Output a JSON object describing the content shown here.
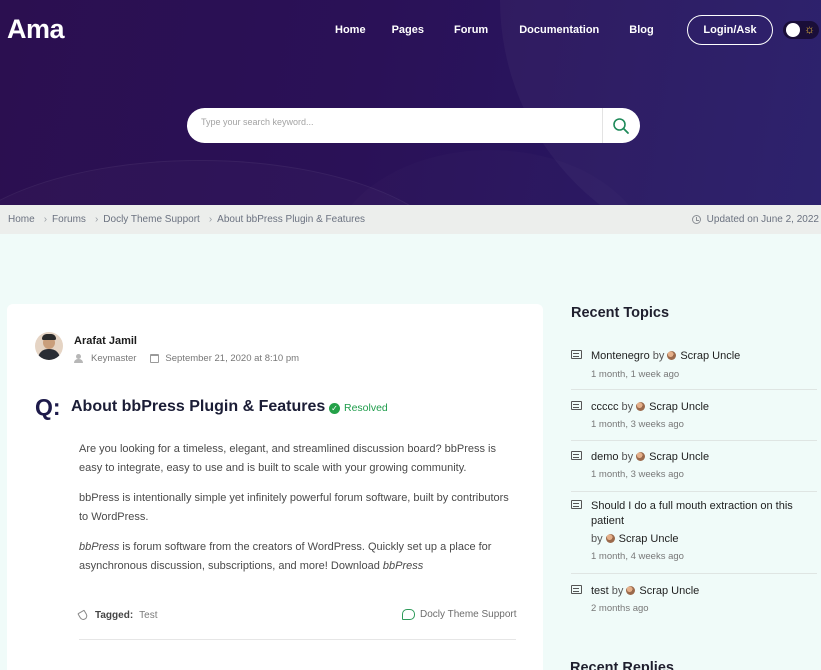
{
  "header": {
    "logo": "Ama",
    "nav": [
      "Home",
      "Pages",
      "Forum",
      "Documentation",
      "Blog"
    ],
    "login_label": "Login/Ask",
    "theme_toggle_icon": "sun-icon"
  },
  "search": {
    "placeholder": "Type your search keyword..."
  },
  "breadcrumb": {
    "items": [
      "Home",
      "Forums",
      "Docly Theme Support",
      "About bbPress Plugin & Features"
    ],
    "updated": "Updated on June 2, 2022"
  },
  "post": {
    "author": "Arafat Jamil",
    "role": "Keymaster",
    "date": "September 21, 2020 at 8:10 pm",
    "q_mark": "Q:",
    "title": "About bbPress Plugin & Features",
    "status": "Resolved",
    "p1": "Are you looking for a timeless, elegant, and streamlined discussion board? bbPress is easy to integrate, easy to use and is built to scale with your growing community.",
    "p2": "bbPress is intentionally simple yet infinitely powerful forum software, built by contributors to WordPress.",
    "p3_em": "bbPress",
    "p3_text": " is forum software from the creators of WordPress. Quickly set up a place for asynchronous discussion, subscriptions, and more! Download ",
    "p3_em2": "bbPress",
    "tagged_label": "Tagged:",
    "tag": "Test",
    "forum": "Docly Theme Support"
  },
  "sidebar": {
    "recent_topics_title": "Recent Topics",
    "by_label": "by",
    "topics": [
      {
        "title": "Montenegro",
        "user": "Scrap Uncle",
        "time": "1 month, 1 week ago"
      },
      {
        "title": "ccccc",
        "user": "Scrap Uncle",
        "time": "1 month, 3 weeks ago"
      },
      {
        "title": "demo",
        "user": "Scrap Uncle",
        "time": "1 month, 3 weeks ago"
      },
      {
        "title": "Should I do a full mouth extraction on this patient",
        "user": "Scrap Uncle",
        "time": "1 month, 4 weeks ago"
      },
      {
        "title": "test",
        "user": "Scrap Uncle",
        "time": "2 months ago"
      }
    ],
    "recent_replies_title": "Recent Replies"
  }
}
